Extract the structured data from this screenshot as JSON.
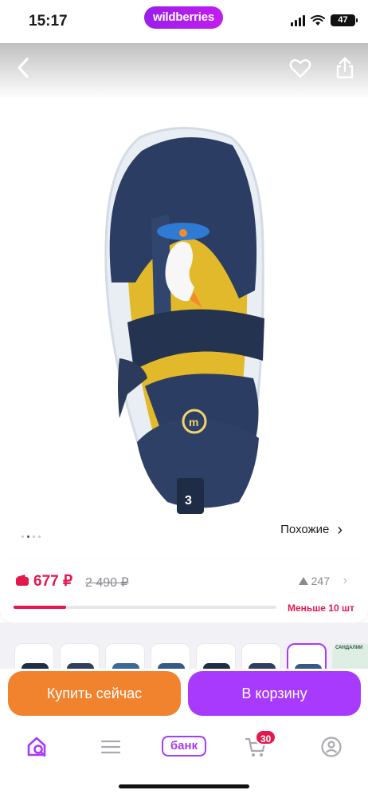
{
  "status": {
    "time": "15:17",
    "battery": "47"
  },
  "brand": {
    "name": "wildberries"
  },
  "header": {
    "back_icon": "chevron-left-icon",
    "favorite_icon": "heart-icon",
    "share_icon": "share-icon"
  },
  "gallery": {
    "similar_label": "Похожие",
    "chevron": "›"
  },
  "price": {
    "current": "677 ₽",
    "old": "2 490 ₽",
    "count": "247",
    "stock_label": "Меньше 10 шт",
    "stock_fraction": 0.2
  },
  "thumbs": {
    "promo_text": "САНДАЛИИ"
  },
  "actions": {
    "buy_now": "Купить сейчас",
    "add_to_cart": "В корзину"
  },
  "tabbar": {
    "bank_label": "банк",
    "cart_count": "30"
  },
  "colors": {
    "accent": "#a73afd",
    "price": "#e3184d",
    "buy": "#f2832e"
  }
}
